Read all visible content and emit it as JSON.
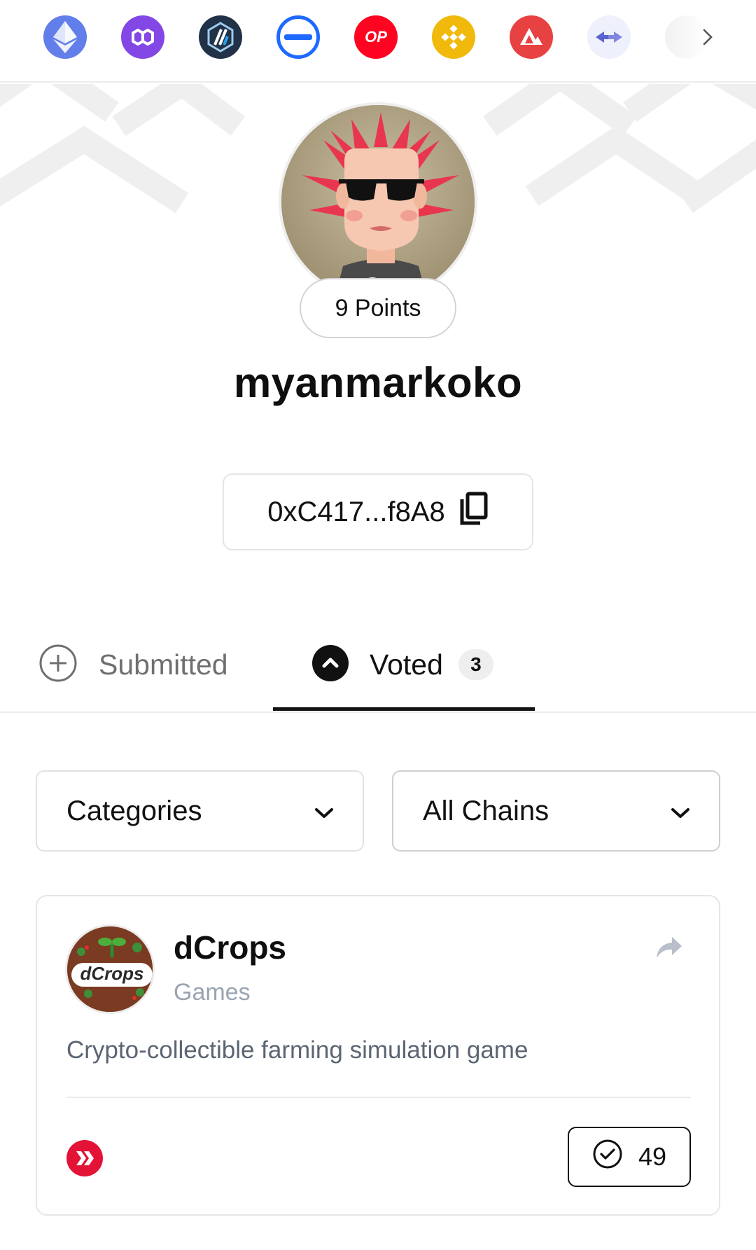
{
  "chain_bar": {
    "chains": [
      {
        "name": "ethereum",
        "color": "#627eea"
      },
      {
        "name": "polygon",
        "color": "#8247e5"
      },
      {
        "name": "arbitrum",
        "color": "#213147"
      },
      {
        "name": "zksync",
        "color": "#1e69ff"
      },
      {
        "name": "optimism",
        "color": "#ff0420",
        "label": "OP"
      },
      {
        "name": "bnb-chain",
        "color": "#f0b90b"
      },
      {
        "name": "avalanche",
        "color": "#e84142"
      },
      {
        "name": "bridge",
        "color": "#eef0fb"
      }
    ],
    "next_icon": "chevron-right-icon"
  },
  "profile": {
    "points_label": "9 Points",
    "username": "myanmarkoko",
    "address": "0xC417...f8A8",
    "copy_icon": "copy-icon"
  },
  "tabs": [
    {
      "label": "Submitted",
      "icon": "plus-circle-icon",
      "active": false
    },
    {
      "label": "Voted",
      "icon": "chevron-up-circle-icon",
      "active": true,
      "count": "3"
    }
  ],
  "filters": {
    "categories_label": "Categories",
    "chains_label": "All Chains"
  },
  "project": {
    "logo_text": "dCrops",
    "name": "dCrops",
    "category": "Games",
    "description": "Crypto-collectible farming simulation game",
    "chain": "hive",
    "chain_color": "#e31337",
    "votes": "49"
  }
}
